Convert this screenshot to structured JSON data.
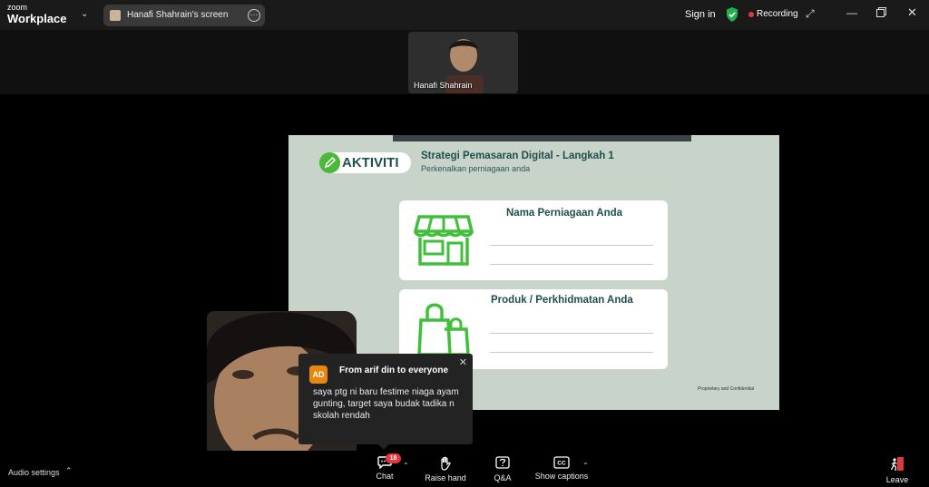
{
  "app": {
    "brand_small": "zoom",
    "brand_large": "Workplace"
  },
  "share": {
    "label": "Hanafi Shahrain's screen"
  },
  "topbar": {
    "sign_in": "Sign in",
    "recording": "Recording"
  },
  "participant_tile": {
    "name": "Hanafi Shahrain"
  },
  "slide": {
    "activity_label": "AKTIVITI",
    "title": "Strategi Pemasaran Digital - Langkah 1",
    "subtitle": "Perkenalkan perniagaan anda",
    "card1_heading": "Nama Perniagaan Anda",
    "card2_heading": "Produk / Perkhidmatan Anda",
    "footer": "Proprietary and Confidential"
  },
  "chat_popup": {
    "avatar": "AD",
    "from": "From arif din to everyone",
    "message": "saya ptg ni baru festime niaga ayam gunting, target saya budak tadika n skolah rendah"
  },
  "toolbar": {
    "audio_settings": "Audio settings",
    "chat": "Chat",
    "chat_badge": "18",
    "raise_hand": "Raise hand",
    "qa": "Q&A",
    "captions": "Show captions",
    "leave": "Leave"
  },
  "colors": {
    "slide_bg": "#c8d3c9",
    "slide_text": "#1e4f4d",
    "activity_green": "#4cb83c",
    "icon_green": "#3fbf3a",
    "record_red": "#e0393e",
    "avatar_orange": "#e8870e"
  }
}
